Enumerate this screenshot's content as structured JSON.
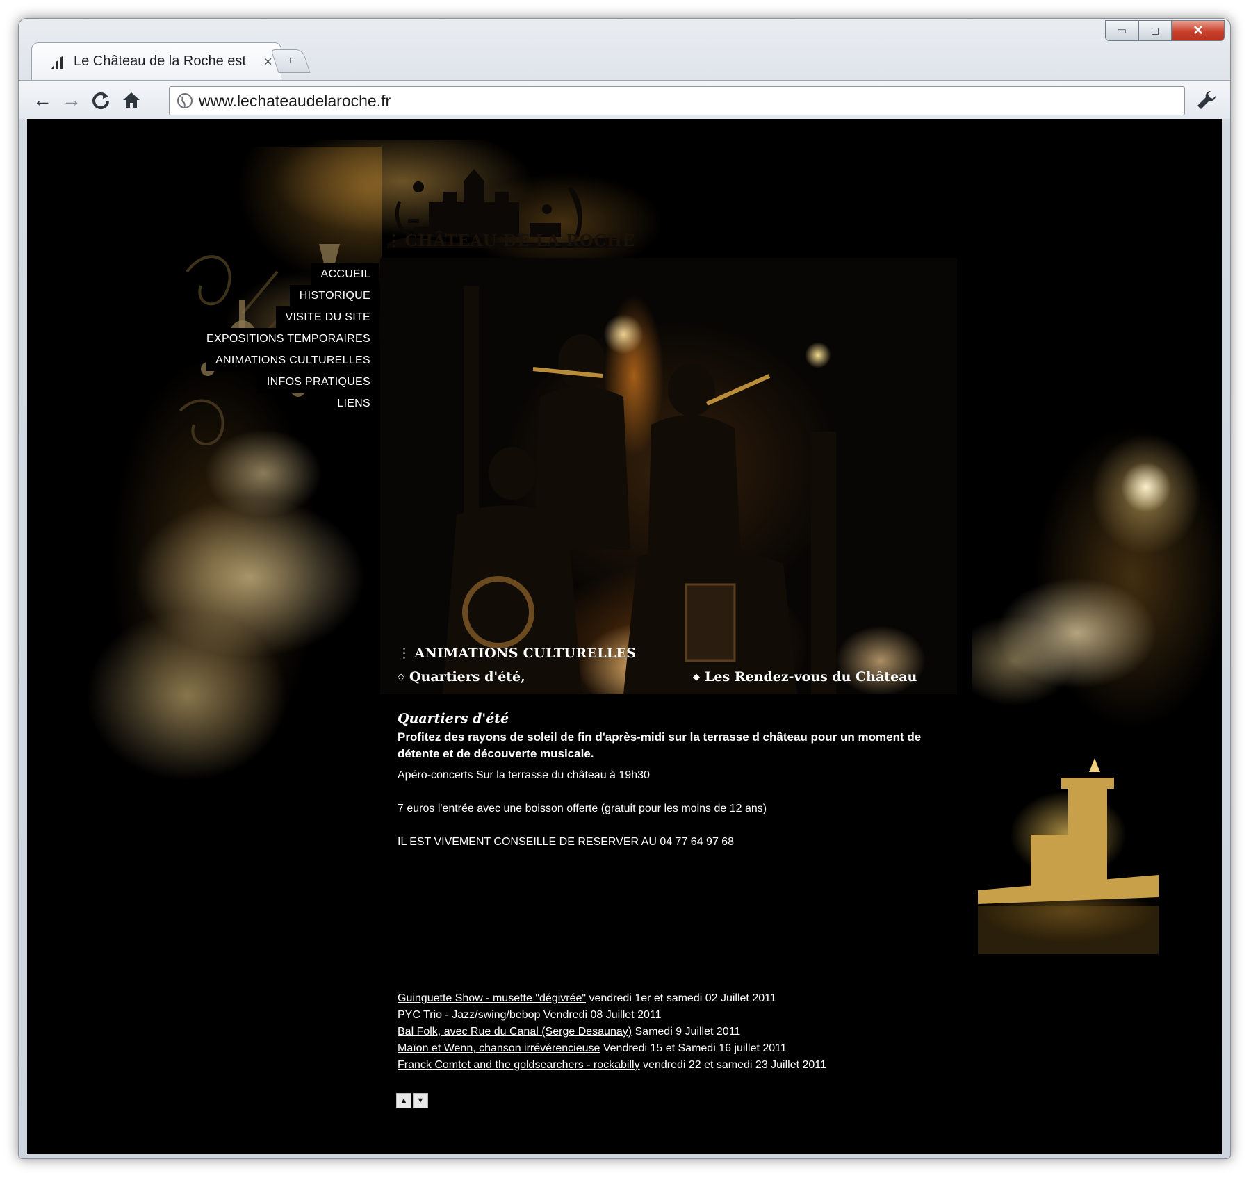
{
  "browser": {
    "tab_title": "Le Château de la Roche est",
    "tab_close": "×",
    "new_tab": "+",
    "url": "www.lechateaudelaroche.fr",
    "back": "←",
    "forward": "→",
    "reload": "C",
    "home": "⌂",
    "minimize": "▭",
    "maximize": "◻",
    "close": "✕"
  },
  "site": {
    "logo_text": "CHÂTEAU DE LA ROCHE",
    "logo_prefix": "⋮",
    "menu": [
      {
        "label": "ACCUEIL"
      },
      {
        "label": "HISTORIQUE"
      },
      {
        "label": "VISITE DU SITE"
      },
      {
        "label": "EXPOSITIONS TEMPORAIRES"
      },
      {
        "label": "ANIMATIONS CULTURELLES"
      },
      {
        "label": "INFOS PRATIQUES"
      },
      {
        "label": "LIENS"
      }
    ],
    "section_prefix": "⋮",
    "section_title": "ANIMATIONS CULTURELLES",
    "subnav": [
      {
        "bullet": "◇",
        "label": "Quartiers d'été,"
      },
      {
        "bullet": "◆",
        "label": "Les Rendez-vous du Château"
      }
    ],
    "content": {
      "heading": "Quartiers d'été",
      "intro": "Profitez des rayons de soleil de fin d'après-midi sur la terrasse d château pour un moment de détente et de découverte musicale.",
      "aperitif": "Apéro-concerts Sur la terrasse du château à 19h30",
      "price": "7 euros l'entrée avec une boisson offerte (gratuit pour les moins de 12 ans)",
      "reservation": "IL EST VIVEMENT CONSEILLE DE RESERVER AU 04 77 64 97 68"
    },
    "events": [
      {
        "link": "Guinguette Show - musette \"dégivrée\"",
        "date": " vendredi 1er et samedi 02 Juillet 2011"
      },
      {
        "link": "PYC Trio - Jazz/swing/bebop",
        "date": " Vendredi 08 Juillet 2011"
      },
      {
        "link": "Bal Folk, avec Rue du Canal (Serge Desaunay)",
        "date": " Samedi 9 Juillet 2011"
      },
      {
        "link": "Maïon et Wenn, chanson irrévérencieuse",
        "date": " Vendredi 15 et Samedi 16 juillet 2011"
      },
      {
        "link": "Franck Comtet and the goldsearchers - rockabilly",
        "date": " vendredi 22 et samedi 23 Juillet 2011"
      }
    ],
    "scroll_up": "▲",
    "scroll_down": "▼"
  },
  "colors": {
    "page_background": "#000000",
    "text": "#ffffff",
    "smoke_gold": "#e2ca91",
    "chrome_close": "#c9412b"
  }
}
